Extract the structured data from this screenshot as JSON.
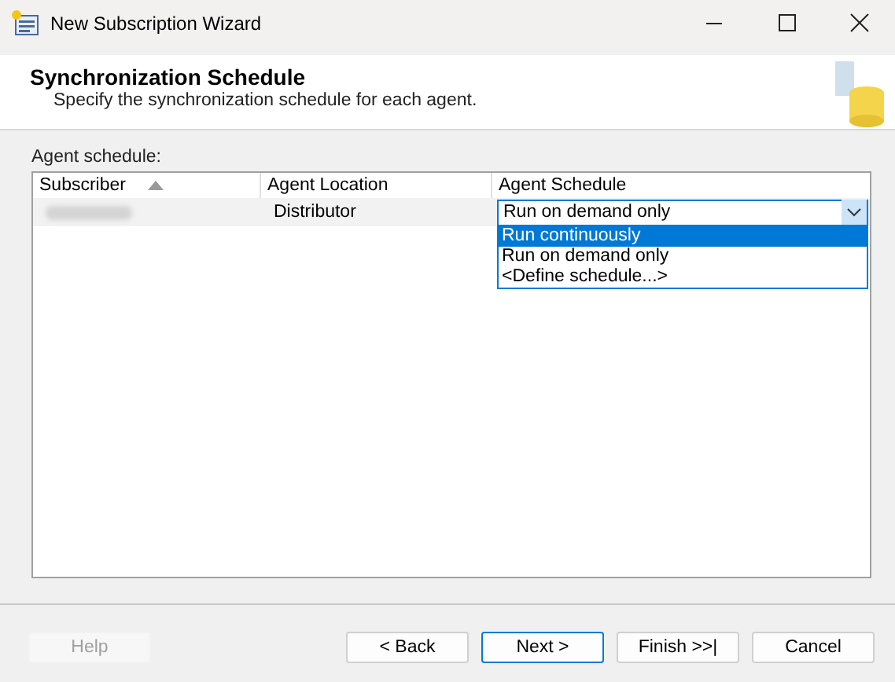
{
  "window": {
    "title": "New Subscription Wizard"
  },
  "header": {
    "title": "Synchronization Schedule",
    "subtitle": "Specify the synchronization schedule for each agent."
  },
  "grid": {
    "label": "Agent schedule:",
    "columns": [
      {
        "label": "Subscriber",
        "sorted": true
      },
      {
        "label": "Agent Location",
        "sorted": false
      },
      {
        "label": "Agent Schedule",
        "sorted": false
      }
    ],
    "rows": [
      {
        "location": "Distributor",
        "schedule": "Run on demand only",
        "expanded": true,
        "options": [
          {
            "label": "Run continuously",
            "selected": true
          },
          {
            "label": "Run on demand only",
            "selected": false
          },
          {
            "label": "<Define schedule...>",
            "selected": false
          }
        ]
      }
    ]
  },
  "buttons": [
    {
      "label": "Help",
      "disabled": true,
      "default": false
    },
    {
      "label": "< Back",
      "disabled": false,
      "default": false
    },
    {
      "label": "Next >",
      "disabled": false,
      "default": true
    },
    {
      "label": "Finish >>|",
      "disabled": false,
      "default": false
    },
    {
      "label": "Cancel",
      "disabled": false,
      "default": false
    }
  ]
}
